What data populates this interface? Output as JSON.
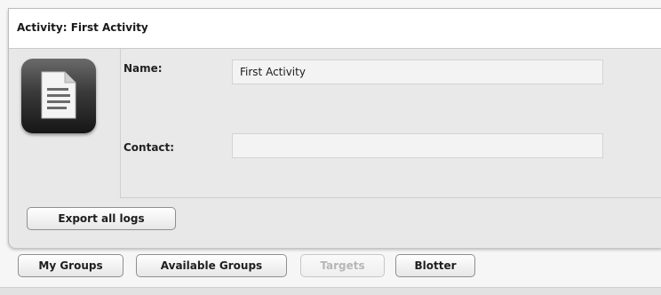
{
  "activity": {
    "title": "Activity: First Activity",
    "icon": "document-icon",
    "name_label": "Name:",
    "name_value": "First Activity",
    "contact_label": "Contact:",
    "contact_value": "",
    "export_button": "Export all logs"
  },
  "tabs": [
    {
      "label": "My Groups",
      "enabled": true
    },
    {
      "label": "Available Groups",
      "enabled": true
    },
    {
      "label": "Targets",
      "enabled": false
    },
    {
      "label": "Blotter",
      "enabled": true
    }
  ]
}
